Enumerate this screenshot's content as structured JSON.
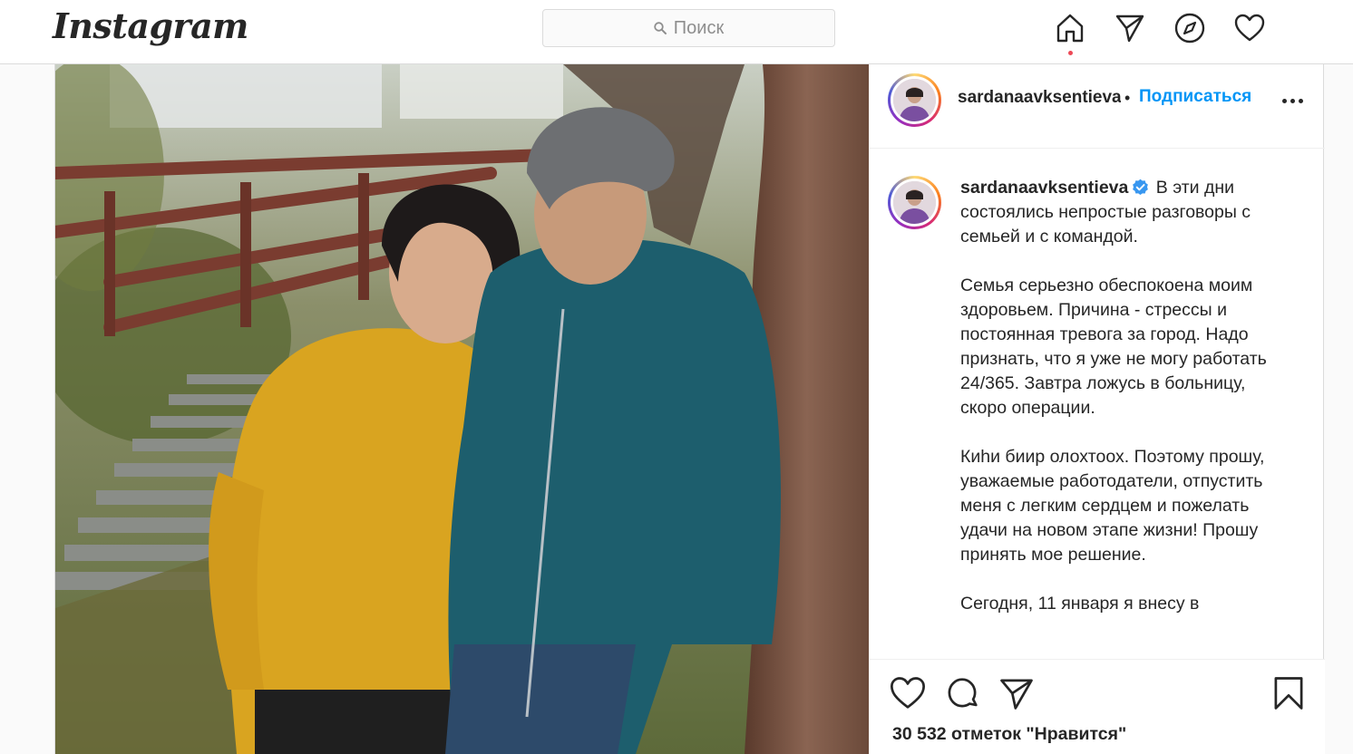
{
  "header": {
    "logo": "Instagram",
    "search_placeholder": "Поиск",
    "nav": [
      {
        "name": "home-icon",
        "active": true
      },
      {
        "name": "direct-icon"
      },
      {
        "name": "explore-icon"
      },
      {
        "name": "activity-heart-icon"
      }
    ]
  },
  "post": {
    "author": "sardanaavksentieva",
    "header_author_display": "sardanaavksentieva",
    "separator": "•",
    "follow_label": "Подписаться",
    "verified": true,
    "caption": "В эти дни состоялись непростые разговоры с семьей и с командой.\n\nСемья серьезно обеспокоена моим здоровьем. Причина - стрессы и постоянная тревога за город. Надо признать, что я уже не могу работать 24/365. Завтра ложусь в больницу, скоро операции.\n\nКиhи биир олохтоох. Поэтому прошу, уважаемые работодатели, отпустить меня с легким сердцем и пожелать удачи на новом этапе жизни! Прошу принять мое решение.\n\nСегодня, 11 января я внесу в",
    "likes": "30 532 отметок \"Нравится\""
  },
  "colors": {
    "accent": "#0095f6",
    "text": "#262626",
    "border": "#dbdbdb",
    "notification_dot": "#ed4956"
  }
}
